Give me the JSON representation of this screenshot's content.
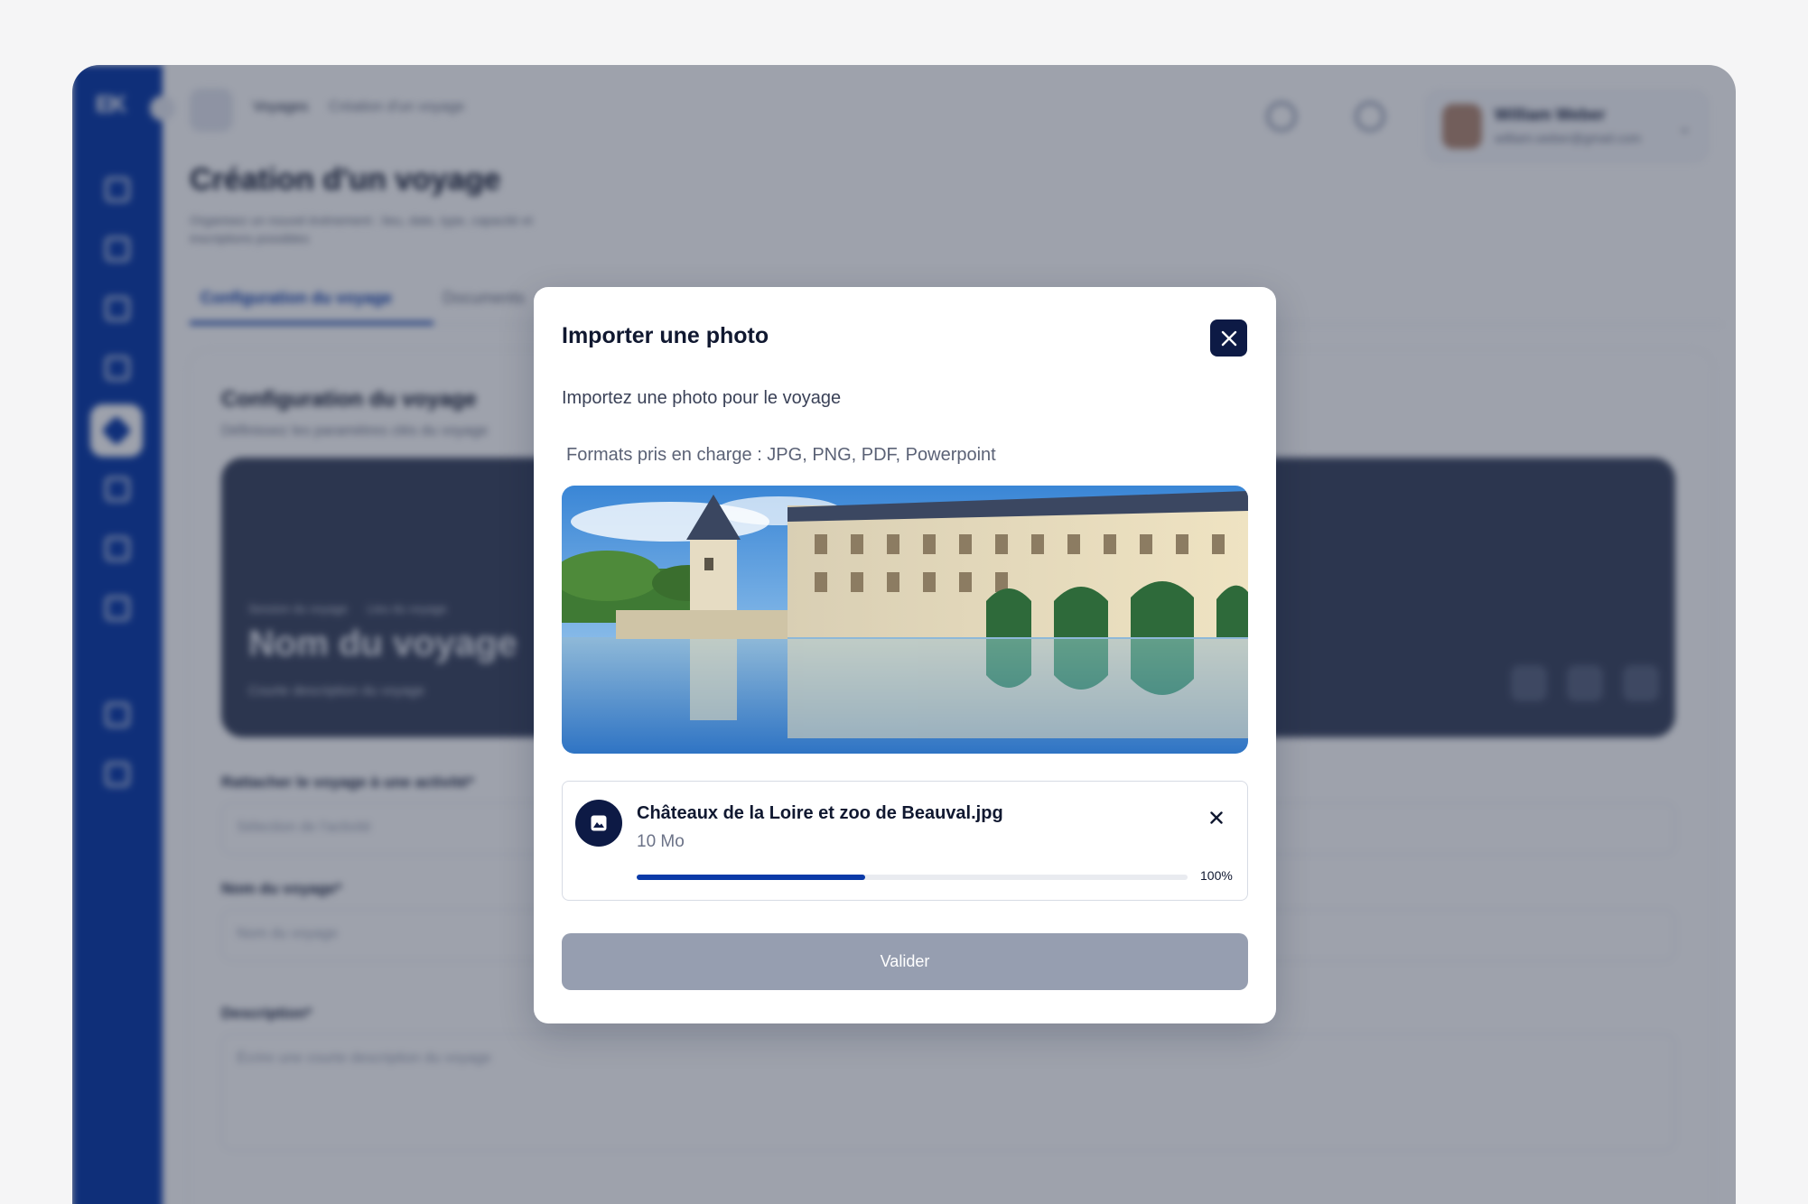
{
  "background": {
    "breadcrumb": {
      "root": "Voyages",
      "current": "Création d'un voyage"
    },
    "page_title": "Création d'un voyage",
    "page_subtitle": "Organisez un nouvel événement : lieu, date, type, capacité et inscriptions possibles",
    "tabs": [
      {
        "label": "Configuration du voyage",
        "active": true
      },
      {
        "label": "Documents",
        "active": false
      }
    ],
    "user": {
      "name": "William Weber",
      "email": "william.weber@gmail.com"
    },
    "card": {
      "title": "Configuration du voyage",
      "subtitle": "Définissez les paramètres clés du voyage",
      "hero": {
        "meta_left": "Session du voyage",
        "meta_right": "Lieu du voyage",
        "name": "Nom du voyage",
        "description": "Courte description du voyage"
      },
      "fields": [
        {
          "label": "Rattacher le voyage à une activité*",
          "placeholder": "Sélection de l'activité"
        },
        {
          "label": "Nom du voyage*",
          "placeholder": "Nom du voyage"
        },
        {
          "label": "Description*",
          "placeholder": "Écrire une courte description du voyage"
        }
      ]
    }
  },
  "modal": {
    "title": "Importer une photo",
    "description": "Importez une photo pour le voyage",
    "formats": "Formats pris en charge : JPG, PNG, PDF, Powerpoint",
    "file": {
      "name": "Châteaux de la Loire et zoo de Beauval.jpg",
      "size": "10 Mo",
      "progress_label": "100%",
      "progress_fill_fraction": 0.415
    },
    "validate_label": "Valider"
  },
  "colors": {
    "primary": "#0a3aa8",
    "navy": "#0d1a45",
    "disabled_button": "#969eb0"
  },
  "icons": {
    "close": "close-icon",
    "file": "image-icon",
    "remove": "remove-file-icon"
  }
}
